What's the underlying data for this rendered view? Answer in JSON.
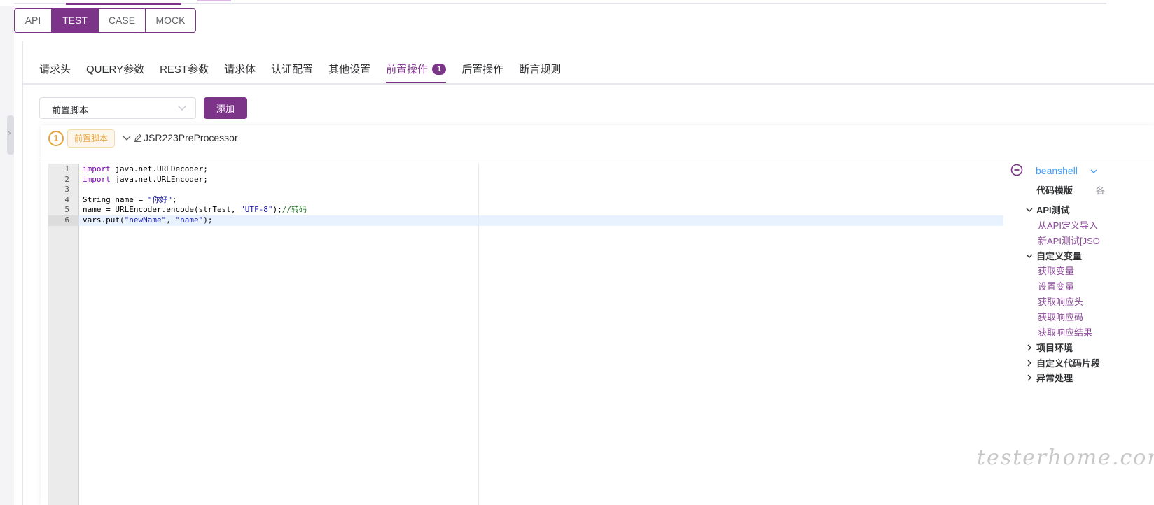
{
  "modes": {
    "items": [
      {
        "label": "API",
        "active": false
      },
      {
        "label": "TEST",
        "active": true
      },
      {
        "label": "CASE",
        "active": false
      },
      {
        "label": "MOCK",
        "active": false
      }
    ]
  },
  "tabs": {
    "items": [
      {
        "label": "请求头"
      },
      {
        "label": "QUERY参数"
      },
      {
        "label": "REST参数"
      },
      {
        "label": "请求体"
      },
      {
        "label": "认证配置"
      },
      {
        "label": "其他设置"
      },
      {
        "label": "前置操作",
        "badge": "1",
        "active": true
      },
      {
        "label": "后置操作"
      },
      {
        "label": "断言规则"
      }
    ]
  },
  "toolbar": {
    "select_value": "前置脚本",
    "add_label": "添加"
  },
  "step": {
    "number": "1",
    "tag": "前置脚本",
    "name": "JSR223PreProcessor"
  },
  "editor": {
    "line_numbers": [
      "1",
      "2",
      "3",
      "4",
      "5",
      "6"
    ],
    "active_line": 6,
    "lines": [
      [
        {
          "t": "import",
          "c": "kw2"
        },
        {
          "t": " java.net.URLDecoder;",
          "c": ""
        }
      ],
      [
        {
          "t": "import",
          "c": "kw2"
        },
        {
          "t": " java.net.URLEncoder;",
          "c": ""
        }
      ],
      [],
      [
        {
          "t": "String name ",
          "c": ""
        },
        {
          "t": "=",
          "c": ""
        },
        {
          "t": " \"你好\"",
          "c": "str"
        },
        {
          "t": ";",
          "c": ""
        }
      ],
      [
        {
          "t": "name = URLEncoder.encode(strTest, ",
          "c": ""
        },
        {
          "t": "\"UTF-8\"",
          "c": "str"
        },
        {
          "t": ");",
          "c": ""
        },
        {
          "t": "//转码",
          "c": "cmt"
        }
      ],
      [
        {
          "t": "vars.put(",
          "c": ""
        },
        {
          "t": "\"newName\"",
          "c": "str"
        },
        {
          "t": ", ",
          "c": ""
        },
        {
          "t": "\"name\"",
          "c": "str"
        },
        {
          "t": ");",
          "c": ""
        }
      ]
    ]
  },
  "templates": {
    "language": "beanshell",
    "title": "代码模版",
    "extra": "各",
    "groups": [
      {
        "label": "API测试",
        "expanded": true,
        "items": [
          "从API定义导入",
          "新API测试[JSO"
        ]
      },
      {
        "label": "自定义变量",
        "expanded": true,
        "items": [
          "获取变量",
          "设置变量",
          "获取响应头",
          "获取响应码",
          "获取响应结果"
        ]
      },
      {
        "label": "项目环境",
        "expanded": false,
        "items": []
      },
      {
        "label": "自定义代码片段",
        "expanded": false,
        "items": []
      },
      {
        "label": "异常处理",
        "expanded": false,
        "items": []
      }
    ]
  },
  "watermark": "testerhome.com",
  "colors": {
    "accent": "#7c3489",
    "warning": "#e6a23c",
    "link": "#409eff"
  }
}
